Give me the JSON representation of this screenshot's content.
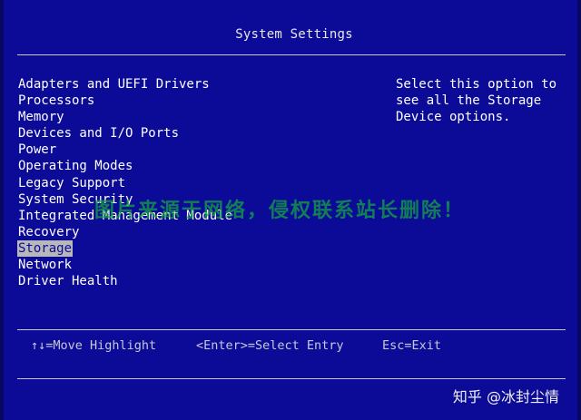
{
  "title": "System Settings",
  "menu": {
    "items": [
      {
        "label": "Adapters and UEFI Drivers"
      },
      {
        "label": "Processors"
      },
      {
        "label": "Memory"
      },
      {
        "label": "Devices and I/O Ports"
      },
      {
        "label": "Power"
      },
      {
        "label": "Operating Modes"
      },
      {
        "label": "Legacy Support"
      },
      {
        "label": "System Security"
      },
      {
        "label": "Integrated Management Module"
      },
      {
        "label": "Recovery"
      },
      {
        "label": "Storage"
      },
      {
        "label": "Network"
      },
      {
        "label": "Driver Health"
      }
    ],
    "selected_index": 10
  },
  "help": {
    "lines": [
      "Select this option to",
      "see all the Storage",
      "Device options."
    ]
  },
  "footer": {
    "move": "↑↓=Move Highlight",
    "enter": "<Enter>=Select Entry",
    "esc": "Esc=Exit"
  },
  "watermark": "图片来源于网络，侵权联系站长删除！",
  "credit": "知乎 @冰封尘情",
  "colors": {
    "background": "#0b0b98",
    "highlight": "#b8b8b8",
    "watermark": "#14aa3c"
  }
}
